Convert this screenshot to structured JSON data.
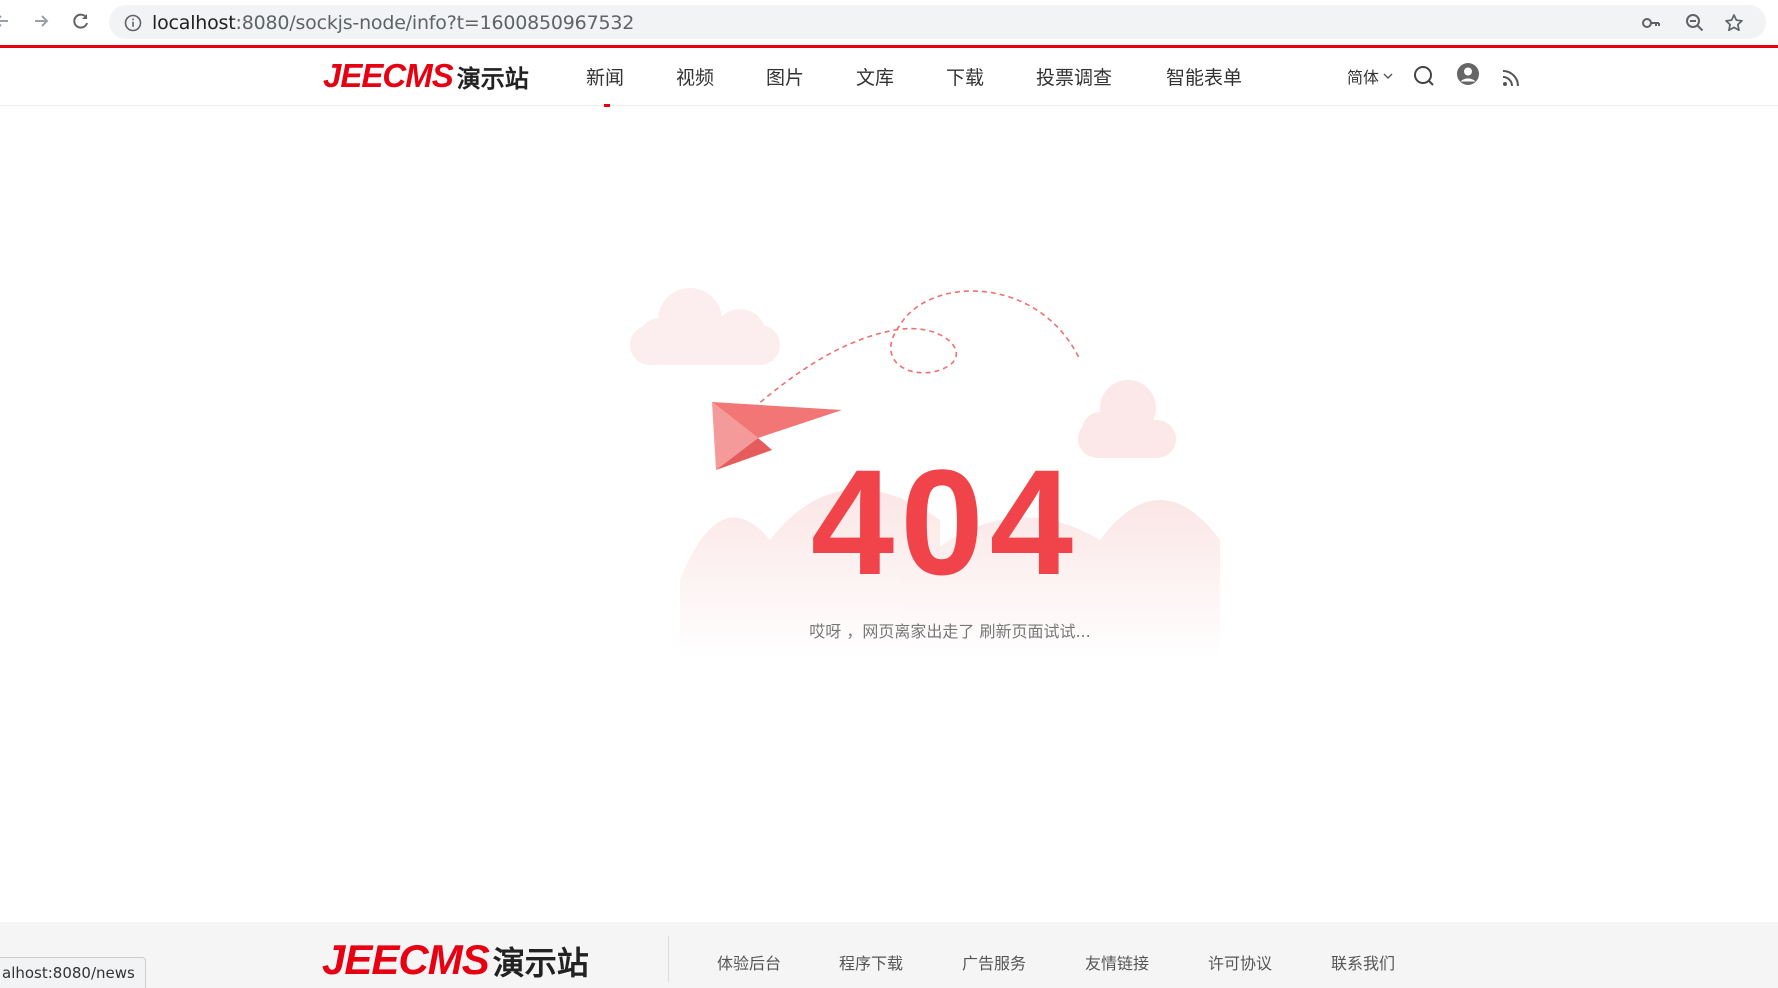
{
  "browser": {
    "url_host": "localhost",
    "url_rest": ":8080/sockjs-node/info?t=1600850967532",
    "back_icon": "arrow-left-icon",
    "forward_icon": "arrow-right-icon",
    "reload_icon": "reload-icon",
    "info_icon": "info-icon",
    "key_icon": "key-icon",
    "zoom_icon": "zoom-out-icon",
    "star_icon": "star-icon"
  },
  "header": {
    "logo_en": "JEECMS",
    "logo_cn": "演示站",
    "menu": [
      {
        "label": "新闻",
        "active": true
      },
      {
        "label": "视频"
      },
      {
        "label": "图片"
      },
      {
        "label": "文库"
      },
      {
        "label": "下载"
      },
      {
        "label": "投票调查"
      },
      {
        "label": "智能表单"
      }
    ],
    "language": "简体"
  },
  "error": {
    "code": "404",
    "message": "哎呀 ，网页离家出走了 刷新页面试试..."
  },
  "footer": {
    "logo_en": "JEECMS",
    "logo_cn": "演示站",
    "links": [
      "体验后台",
      "程序下载",
      "广告服务",
      "友情链接",
      "许可协议",
      "联系我们"
    ]
  },
  "status_bar": "alhost:8080/news",
  "colors": {
    "brand_red": "#e60012",
    "digit_red": "#f0444a"
  }
}
